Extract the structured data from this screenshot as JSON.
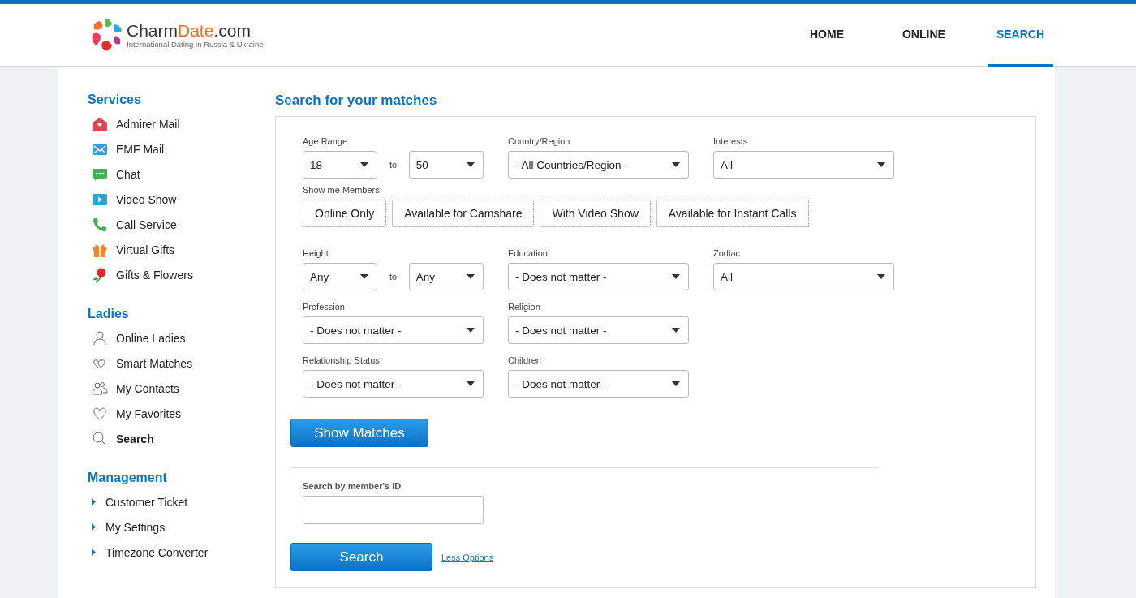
{
  "header": {
    "logo": {
      "name": "Charm**Date**.com",
      "tagline": "International Dating in Russia & Ukraine"
    },
    "nav": [
      {
        "label": "HOME",
        "selected": false
      },
      {
        "label": "ONLINE",
        "selected": false
      },
      {
        "label": "SEARCH",
        "selected": true
      }
    ]
  },
  "sidebar": {
    "sections": [
      {
        "title": "Services",
        "kind": "color",
        "items": [
          {
            "label": "Admirer Mail",
            "selected": false
          },
          {
            "label": "EMF Mail",
            "selected": false
          },
          {
            "label": "Chat",
            "selected": false
          },
          {
            "label": "Video Show",
            "selected": false
          },
          {
            "label": "Call Service",
            "selected": false
          },
          {
            "label": "Virtual Gifts",
            "selected": false
          },
          {
            "label": "Gifts & Flowers",
            "selected": false
          }
        ]
      },
      {
        "title": "Ladies",
        "kind": "outline",
        "items": [
          {
            "label": "Online Ladies",
            "selected": false
          },
          {
            "label": "Smart Matches",
            "selected": false
          },
          {
            "label": "My Contacts",
            "selected": false
          },
          {
            "label": "My Favorites",
            "selected": false
          },
          {
            "label": "Search",
            "selected": true
          }
        ]
      },
      {
        "title": "Management",
        "kind": "arrow",
        "items": [
          {
            "label": "Customer Ticket",
            "selected": false
          },
          {
            "label": "My Settings",
            "selected": false
          },
          {
            "label": "Timezone Converter",
            "selected": false
          }
        ]
      }
    ]
  },
  "main": {
    "title": "Search for your matches",
    "form": {
      "rows": [
        {
          "fields": [
            {
              "kind": "range",
              "label": "Age Range",
              "from": "18",
              "separator": "to",
              "to": "50"
            },
            {
              "kind": "select",
              "label": "Country/Region",
              "value": "- All Countries/Region -"
            },
            {
              "kind": "select",
              "label": "Interests",
              "value": "All"
            }
          ]
        },
        {
          "fields": [
            {
              "kind": "toggles",
              "label": "Show me Members:",
              "options": [
                "Online Only",
                "Available for Camshare",
                "With Video Show",
                "Available for Instant Calls"
              ]
            }
          ]
        },
        {
          "fields": [
            {
              "kind": "range",
              "label": "Height",
              "from": "Any",
              "separator": "to",
              "to": "Any"
            },
            {
              "kind": "select",
              "label": "Education",
              "value": "- Does not matter -"
            },
            {
              "kind": "select",
              "label": "Zodiac",
              "value": "All"
            }
          ]
        },
        {
          "fields": [
            {
              "kind": "select",
              "label": "Profession",
              "value": "- Does not matter -"
            },
            {
              "kind": "select",
              "label": "Religion",
              "value": "- Does not matter -"
            }
          ]
        },
        {
          "fields": [
            {
              "kind": "select",
              "label": "Relationship Status",
              "value": "- Does not matter -"
            },
            {
              "kind": "select",
              "label": "Children",
              "value": "- Does not matter -"
            }
          ]
        }
      ],
      "submit": "Show Matches"
    },
    "id_search": {
      "label": "Search by member's ID",
      "button": "Search",
      "link": "Less Options"
    }
  }
}
